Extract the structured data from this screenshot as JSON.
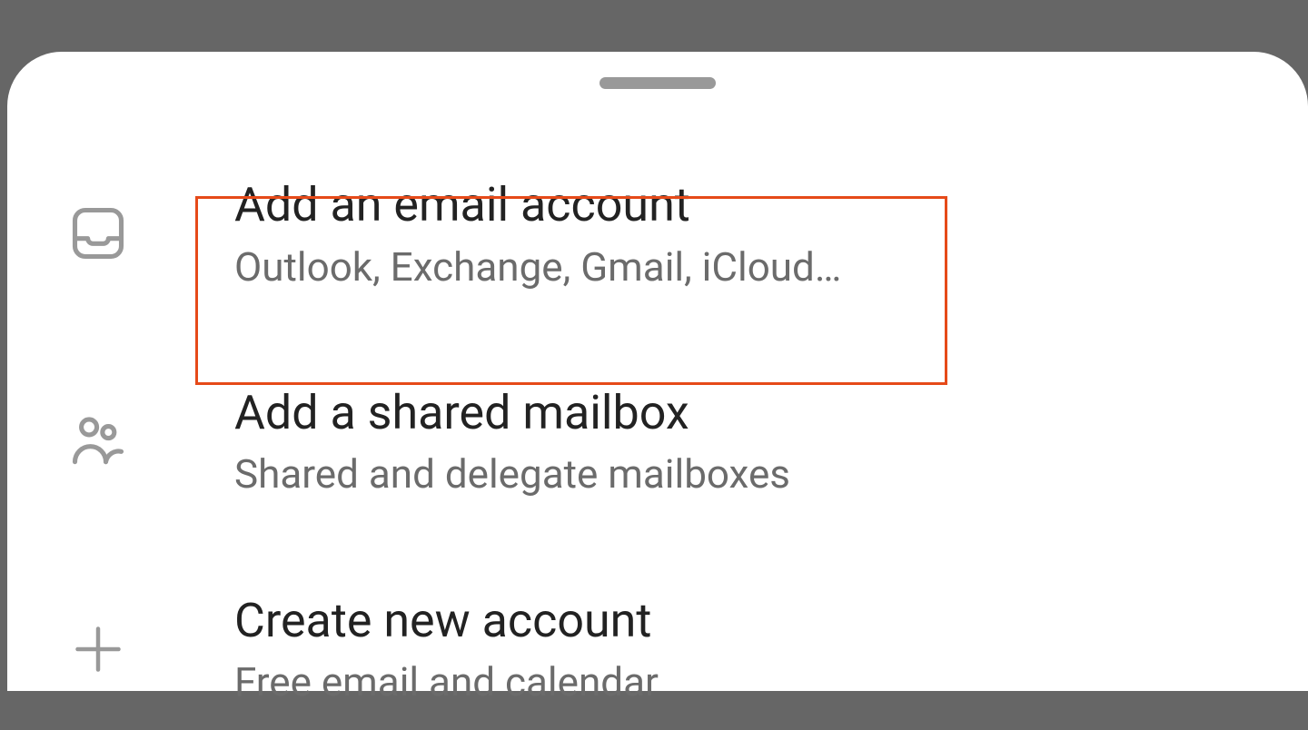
{
  "menu": {
    "items": [
      {
        "title": "Add an email account",
        "subtitle": "Outlook, Exchange, Gmail, iCloud…",
        "icon": "inbox-icon"
      },
      {
        "title": "Add a shared mailbox",
        "subtitle": "Shared and delegate mailboxes",
        "icon": "people-icon"
      },
      {
        "title": "Create new account",
        "subtitle": "Free email and calendar",
        "icon": "plus-icon"
      }
    ]
  },
  "highlighted_index": 0
}
